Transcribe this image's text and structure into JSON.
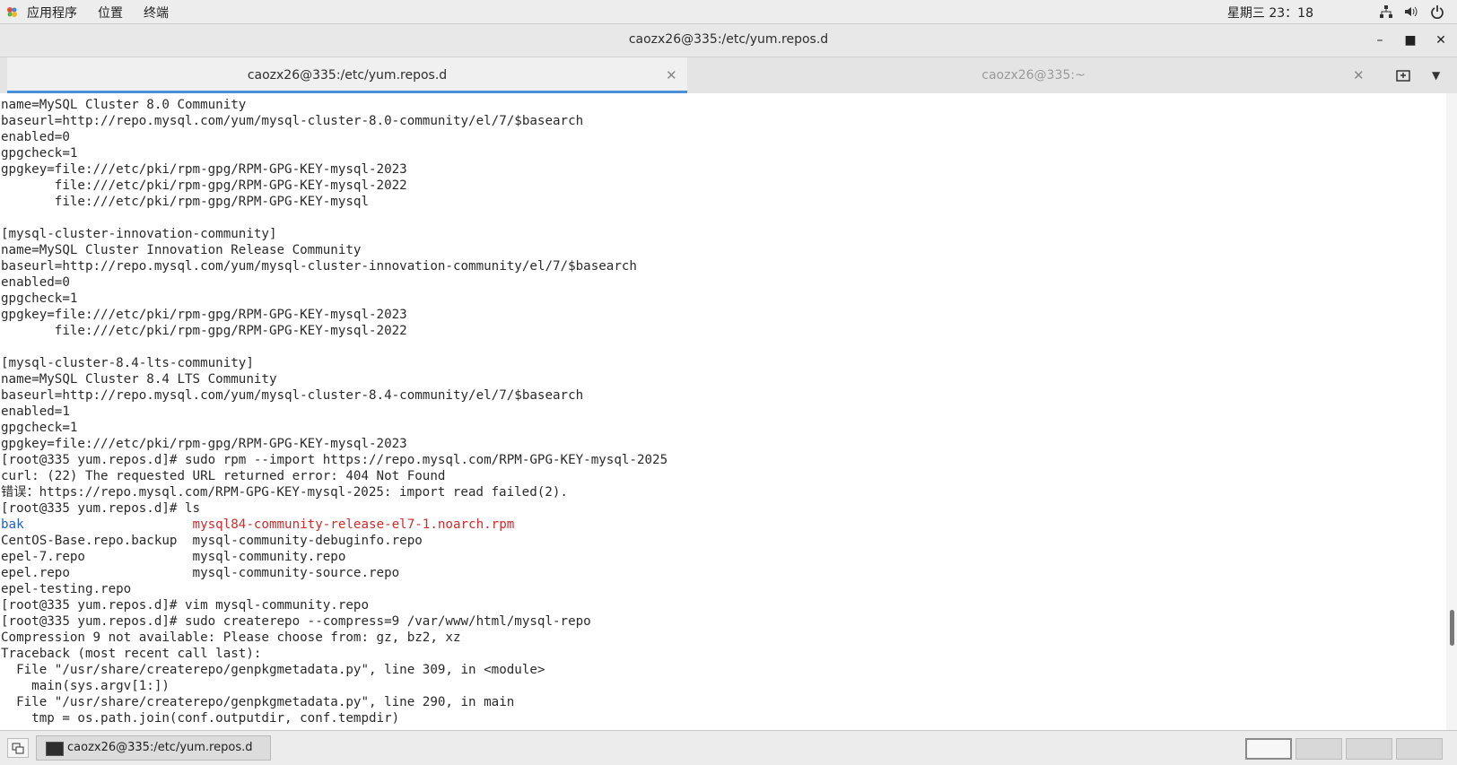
{
  "topbar": {
    "menus": [
      "应用程序",
      "位置",
      "终端"
    ],
    "clock": "星期三 23：18",
    "icons": [
      "gnome-apps-icon",
      "network-icon",
      "volume-icon",
      "power-icon"
    ]
  },
  "window": {
    "title": "caozx26@335:/etc/yum.repos.d",
    "buttons": [
      "minimize",
      "maximize",
      "close"
    ]
  },
  "tabs": [
    {
      "label": "caozx26@335:/etc/yum.repos.d",
      "active": true
    },
    {
      "label": "caozx26@335:~",
      "active": false
    }
  ],
  "terminal": {
    "lines": [
      "name=MySQL Cluster 8.0 Community",
      "baseurl=http://repo.mysql.com/yum/mysql-cluster-8.0-community/el/7/$basearch",
      "enabled=0",
      "gpgcheck=1",
      "gpgkey=file:///etc/pki/rpm-gpg/RPM-GPG-KEY-mysql-2023",
      "       file:///etc/pki/rpm-gpg/RPM-GPG-KEY-mysql-2022",
      "       file:///etc/pki/rpm-gpg/RPM-GPG-KEY-mysql",
      "",
      "[mysql-cluster-innovation-community]",
      "name=MySQL Cluster Innovation Release Community",
      "baseurl=http://repo.mysql.com/yum/mysql-cluster-innovation-community/el/7/$basearch",
      "enabled=0",
      "gpgcheck=1",
      "gpgkey=file:///etc/pki/rpm-gpg/RPM-GPG-KEY-mysql-2023",
      "       file:///etc/pki/rpm-gpg/RPM-GPG-KEY-mysql-2022",
      "",
      "[mysql-cluster-8.4-lts-community]",
      "name=MySQL Cluster 8.4 LTS Community",
      "baseurl=http://repo.mysql.com/yum/mysql-cluster-8.4-community/el/7/$basearch",
      "enabled=1",
      "gpgcheck=1",
      "gpgkey=file:///etc/pki/rpm-gpg/RPM-GPG-KEY-mysql-2023",
      "[root@335 yum.repos.d]# sudo rpm --import https://repo.mysql.com/RPM-GPG-KEY-mysql-2025",
      "curl: (22) The requested URL returned error: 404 Not Found",
      "错误：https://repo.mysql.com/RPM-GPG-KEY-mysql-2025: import read failed(2).",
      "[root@335 yum.repos.d]# ls"
    ],
    "ls_rows": [
      {
        "left": "bak",
        "right": "mysql84-community-release-el7-1.noarch.rpm"
      },
      {
        "left": "CentOS-Base.repo.backup",
        "right": "mysql-community-debuginfo.repo"
      },
      {
        "left": "epel-7.repo",
        "right": "mysql-community.repo"
      },
      {
        "left": "epel.repo",
        "right": "mysql-community-source.repo"
      },
      {
        "left": "epel-testing.repo",
        "right": ""
      }
    ],
    "lines_after": [
      "[root@335 yum.repos.d]# vim mysql-community.repo",
      "[root@335 yum.repos.d]# sudo createrepo --compress=9 /var/www/html/mysql-repo",
      "Compression 9 not available: Please choose from: gz, bz2, xz",
      "Traceback (most recent call last):",
      "  File \"/usr/share/createrepo/genpkgmetadata.py\", line 309, in <module>",
      "    main(sys.argv[1:])",
      "  File \"/usr/share/createrepo/genpkgmetadata.py\", line 290, in main",
      "    tmp = os.path.join(conf.outputdir, conf.tempdir)"
    ],
    "colors": {
      "directory": "#1f5fcf",
      "rpm_file": "#d32a2a"
    }
  },
  "taskbar": {
    "task_label": "caozx26@335:/etc/yum.repos.d",
    "workspaces": 4,
    "active_workspace": 1
  }
}
